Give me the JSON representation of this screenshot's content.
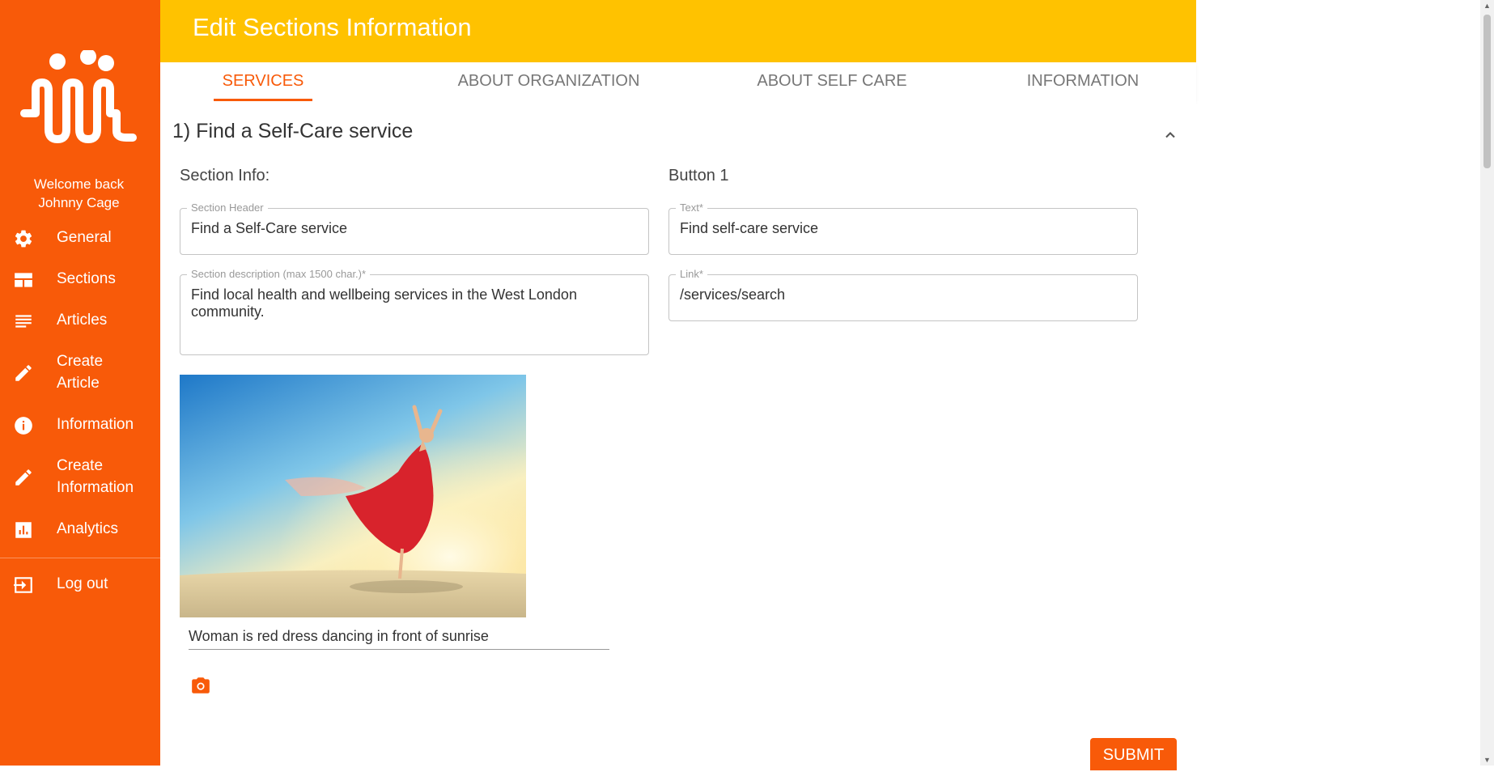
{
  "sidebar": {
    "welcome_line1": "Welcome back",
    "welcome_line2": "Johnny Cage",
    "items": [
      {
        "label": "General",
        "icon": "gear-icon"
      },
      {
        "label": "Sections",
        "icon": "sections-icon"
      },
      {
        "label": "Articles",
        "icon": "articles-icon"
      },
      {
        "label": "Create",
        "label2": "Article",
        "icon": "pencil-icon"
      },
      {
        "label": "Information",
        "icon": "info-icon"
      },
      {
        "label": "Create",
        "label2": "Information",
        "icon": "pencil-icon"
      },
      {
        "label": "Analytics",
        "icon": "analytics-icon"
      },
      {
        "label": "Log out",
        "icon": "logout-icon"
      }
    ]
  },
  "header": {
    "title": "Edit Sections Information"
  },
  "tabs": [
    {
      "label": "SERVICES",
      "active": true
    },
    {
      "label": "ABOUT ORGANIZATION",
      "active": false
    },
    {
      "label": "ABOUT SELF CARE",
      "active": false
    },
    {
      "label": "INFORMATION",
      "active": false
    }
  ],
  "panel": {
    "title": "1) Find a Self-Care service",
    "section_info_title": "Section Info:",
    "button_title": "Button 1",
    "section_header": {
      "label": "Section Header",
      "value": "Find a Self-Care service"
    },
    "section_description": {
      "label": "Section description (max 1500 char.)*",
      "value": "Find local health and wellbeing services in the West London community."
    },
    "button_text": {
      "label": "Text*",
      "value": "Find self-care service"
    },
    "button_link": {
      "label": "Link*",
      "value": "/services/search"
    },
    "image_caption": "Woman is red dress dancing in front of sunrise",
    "submit_label": "SUBMIT"
  },
  "colors": {
    "brand_orange": "#f85a09",
    "header_yellow": "#ffc200"
  }
}
